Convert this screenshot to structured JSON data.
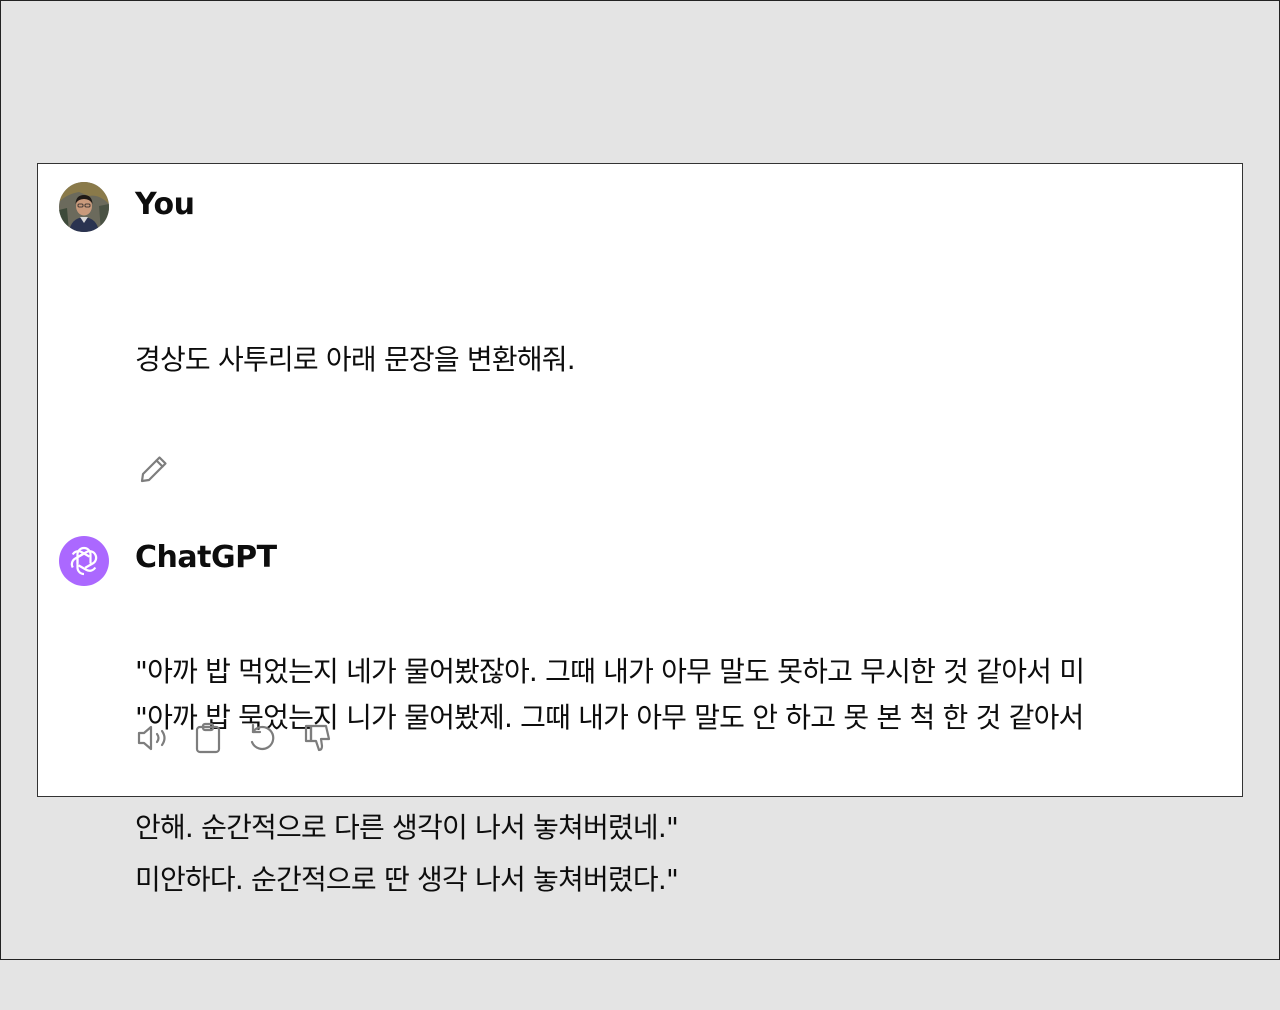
{
  "conversation": {
    "user": {
      "name": "You",
      "avatar_icon": "user-photo-avatar",
      "lines": [
        "경상도 사투리로 아래 문장을 변환해줘.",
        "",
        "\"아까 밥 먹었는지 네가 물어봤잖아. 그때 내가 아무 말도 못하고 무시한 것 같아서 미",
        "안해. 순간적으로 다른 생각이 나서 놓쳐버렸네.\""
      ],
      "edit_icon": "pencil-icon"
    },
    "assistant": {
      "name": "ChatGPT",
      "avatar_icon": "openai-logo-icon",
      "avatar_color": "#ab68ff",
      "lines": [
        "\"아까 밥 묵었는지 니가 물어봤제. 그때 내가 아무 말도 안 하고 못 본 척 한 것 같아서",
        "미안하다. 순간적으로 딴 생각 나서 놓쳐버렸다.\""
      ],
      "actions": [
        {
          "name": "read-aloud-button",
          "icon": "speaker-icon"
        },
        {
          "name": "copy-button",
          "icon": "clipboard-icon"
        },
        {
          "name": "regenerate-button",
          "icon": "refresh-icon"
        },
        {
          "name": "bad-response-button",
          "icon": "thumbs-down-icon"
        }
      ]
    }
  }
}
